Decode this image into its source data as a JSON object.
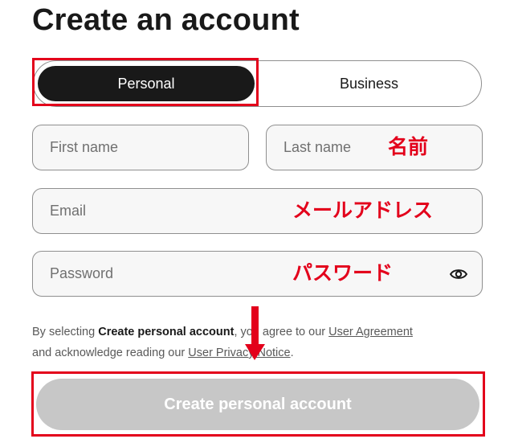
{
  "page": {
    "title": "Create an account"
  },
  "account_type": {
    "options": [
      "Personal",
      "Business"
    ],
    "selected": "Personal"
  },
  "form": {
    "first_name_placeholder": "First name",
    "last_name_placeholder": "Last name",
    "email_placeholder": "Email",
    "password_placeholder": "Password",
    "password_toggle_icon": "eye-icon"
  },
  "annotations": {
    "name_note": "名前",
    "email_note": "メールアドレス",
    "password_note": "パスワード",
    "highlight_color": "#e3001b"
  },
  "legal": {
    "prefix": "By selecting ",
    "bold": "Create personal account",
    "middle": ", you agree to our ",
    "user_agreement": "User Agreement",
    "line2_prefix": "and acknowledge reading our ",
    "privacy_notice": "User Privacy Notice",
    "suffix": "."
  },
  "submit": {
    "label": "Create personal account",
    "enabled": false
  },
  "colors": {
    "primary_text": "#191919",
    "selected_toggle_bg": "#191919",
    "disabled_button_bg": "#c7c7c7",
    "input_border": "#8f8f8f"
  }
}
